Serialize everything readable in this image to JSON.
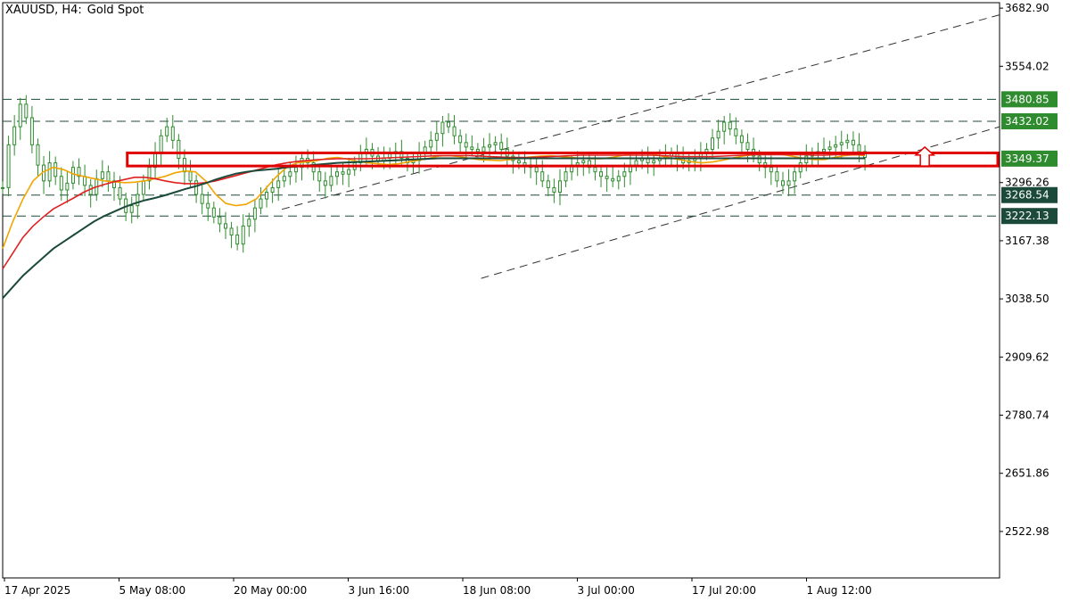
{
  "header": {
    "symbol": "XAUUSD, H4:",
    "description": "Gold Spot"
  },
  "colors": {
    "background": "#ffffff",
    "candle": "#2e8b2e",
    "ma_fast": "#f0a500",
    "ma_mid": "#e02020",
    "ma_slow": "#1c4a3a",
    "zone_border": "#e00000",
    "guide_line": "#1c4a3a",
    "tag_green": "#2e8b2e",
    "tag_dark": "#1c4a3a"
  },
  "chart_data": {
    "type": "line",
    "title": "XAUUSD, H4: Gold Spot",
    "y_axis": {
      "ticks": [
        3682.9,
        3554.02,
        3296.26,
        3167.38,
        3038.5,
        2909.62,
        2780.74,
        2651.86,
        2522.98
      ],
      "range": [
        2420,
        3695
      ]
    },
    "x_axis": {
      "labels": [
        "17 Apr 2025",
        "5 May 08:00",
        "20 May 00:00",
        "3 Jun 16:00",
        "18 Jun 08:00",
        "3 Jul 00:00",
        "17 Jul 20:00",
        "1 Aug 12:00"
      ]
    },
    "grid": false,
    "price_tags": [
      {
        "label": "3480.85",
        "value": 3480.85,
        "style": "green"
      },
      {
        "label": "3432.02",
        "value": 3432.02,
        "style": "green"
      },
      {
        "label": "3349.37",
        "value": 3349.37,
        "style": "green"
      },
      {
        "label": "3268.54",
        "value": 3268.54,
        "style": "dark"
      },
      {
        "label": "3222.13",
        "value": 3222.13,
        "style": "dark"
      }
    ],
    "horizontal_levels": [
      3480.85,
      3432.02,
      3268.54,
      3222.13
    ],
    "resistance_zone": {
      "low": 3333,
      "high": 3362
    },
    "arrow": {
      "direction": "up",
      "value_low": 3333,
      "value_high": 3375
    },
    "channel_upper": [
      {
        "t": 0.28,
        "v": 3237
      },
      {
        "t": 1.0,
        "v": 3668
      }
    ],
    "channel_lower": [
      {
        "t": 0.48,
        "v": 3084
      },
      {
        "t": 1.0,
        "v": 3420
      }
    ],
    "ohlc_close": [
      3285,
      3380,
      3420,
      3470,
      3440,
      3380,
      3335,
      3300,
      3340,
      3310,
      3280,
      3295,
      3330,
      3310,
      3290,
      3270,
      3305,
      3320,
      3300,
      3285,
      3260,
      3230,
      3245,
      3270,
      3300,
      3330,
      3360,
      3400,
      3420,
      3390,
      3350,
      3320,
      3300,
      3270,
      3250,
      3240,
      3220,
      3205,
      3195,
      3180,
      3160,
      3200,
      3215,
      3240,
      3260,
      3275,
      3285,
      3300,
      3310,
      3320,
      3330,
      3350,
      3340,
      3320,
      3300,
      3290,
      3310,
      3320,
      3315,
      3325,
      3340,
      3360,
      3370,
      3355,
      3345,
      3350,
      3360,
      3365,
      3350,
      3340,
      3345,
      3360,
      3375,
      3390,
      3405,
      3430,
      3420,
      3400,
      3385,
      3375,
      3370,
      3365,
      3375,
      3380,
      3385,
      3370,
      3355,
      3345,
      3340,
      3335,
      3330,
      3320,
      3300,
      3285,
      3275,
      3300,
      3320,
      3335,
      3340,
      3345,
      3330,
      3320,
      3310,
      3305,
      3300,
      3310,
      3320,
      3335,
      3345,
      3350,
      3340,
      3345,
      3350,
      3355,
      3360,
      3350,
      3340,
      3345,
      3350,
      3360,
      3370,
      3395,
      3410,
      3430,
      3415,
      3400,
      3385,
      3370,
      3355,
      3340,
      3330,
      3320,
      3300,
      3290,
      3300,
      3320,
      3340,
      3355,
      3360,
      3365,
      3370,
      3375,
      3380,
      3385,
      3390,
      3380,
      3365,
      3352
    ],
    "series": [
      {
        "name": "",
        "values": [
          3150,
          3210,
          3260,
          3300,
          3320,
          3330,
          3325,
          3315,
          3310,
          3305,
          3300,
          3298,
          3296,
          3297,
          3300,
          3305,
          3310,
          3318,
          3322,
          3320,
          3300,
          3270,
          3250,
          3245,
          3248,
          3260,
          3285,
          3310,
          3330,
          3340,
          3342,
          3345,
          3350,
          3352,
          3348,
          3343,
          3340,
          3338,
          3336,
          3338,
          3342,
          3346,
          3350,
          3355,
          3356,
          3354,
          3350,
          3347,
          3346,
          3345,
          3347,
          3350,
          3353,
          3355,
          3356,
          3354,
          3352,
          3350,
          3349,
          3349,
          3352,
          3356,
          3360,
          3362,
          3360,
          3355,
          3350,
          3346,
          3342,
          3340,
          3342,
          3346,
          3351,
          3355,
          3358,
          3360,
          3360,
          3358,
          3354,
          3350,
          3347,
          3347,
          3352,
          3356,
          3358,
          3356
        ]
      },
      {
        "name": "",
        "values": [
          3105,
          3140,
          3175,
          3200,
          3220,
          3238,
          3250,
          3262,
          3275,
          3285,
          3292,
          3298,
          3303,
          3308,
          3308,
          3305,
          3300,
          3296,
          3294,
          3294,
          3296,
          3300,
          3306,
          3312,
          3318,
          3324,
          3330,
          3336,
          3340,
          3343,
          3345,
          3347,
          3348,
          3349,
          3349,
          3349,
          3349,
          3350,
          3351,
          3352,
          3353,
          3354,
          3355,
          3356,
          3356,
          3356,
          3356,
          3355,
          3354,
          3353,
          3352,
          3352,
          3352,
          3353,
          3354,
          3355,
          3356,
          3357,
          3357,
          3357,
          3357,
          3357,
          3357,
          3357,
          3357,
          3356,
          3355,
          3354,
          3354,
          3354,
          3354,
          3355,
          3356,
          3357,
          3358,
          3358,
          3358,
          3358,
          3358,
          3358,
          3357,
          3357,
          3358,
          3358,
          3358,
          3358
        ]
      },
      {
        "name": "",
        "values": [
          3040,
          3065,
          3090,
          3110,
          3130,
          3150,
          3165,
          3180,
          3195,
          3210,
          3222,
          3232,
          3242,
          3250,
          3257,
          3262,
          3268,
          3275,
          3282,
          3288,
          3295,
          3303,
          3310,
          3316,
          3320,
          3323,
          3325,
          3327,
          3330,
          3332,
          3334,
          3336,
          3338,
          3340,
          3341,
          3342,
          3343,
          3344,
          3345,
          3346,
          3347,
          3348,
          3349,
          3350,
          3350,
          3350,
          3350,
          3350,
          3350,
          3350,
          3350,
          3350,
          3350,
          3350,
          3350,
          3350,
          3350,
          3350,
          3350,
          3350,
          3350,
          3350,
          3350,
          3350,
          3350,
          3350,
          3350,
          3350,
          3350,
          3350,
          3350,
          3350,
          3350,
          3350,
          3350,
          3350,
          3350,
          3350,
          3350,
          3350,
          3350,
          3350,
          3350,
          3350,
          3350,
          3350
        ]
      }
    ]
  }
}
